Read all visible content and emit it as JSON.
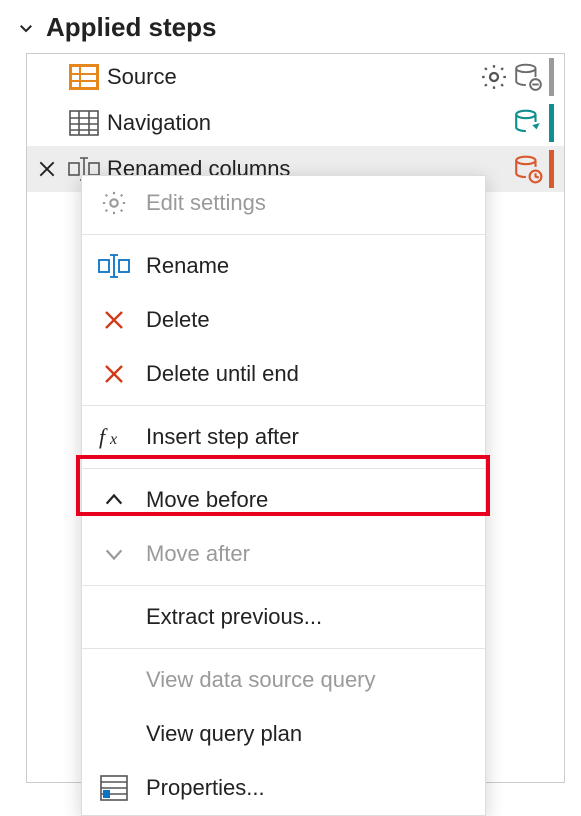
{
  "header": {
    "title": "Applied steps"
  },
  "steps": [
    {
      "label": "Source"
    },
    {
      "label": "Navigation"
    },
    {
      "label": "Renamed columns"
    }
  ],
  "menu": {
    "edit_settings": "Edit settings",
    "rename": "Rename",
    "delete": "Delete",
    "delete_until_end": "Delete until end",
    "insert_step_after": "Insert step after",
    "move_before": "Move before",
    "move_after": "Move after",
    "extract_previous": "Extract previous...",
    "view_data_source_query": "View data source query",
    "view_query_plan": "View query plan",
    "properties": "Properties..."
  }
}
